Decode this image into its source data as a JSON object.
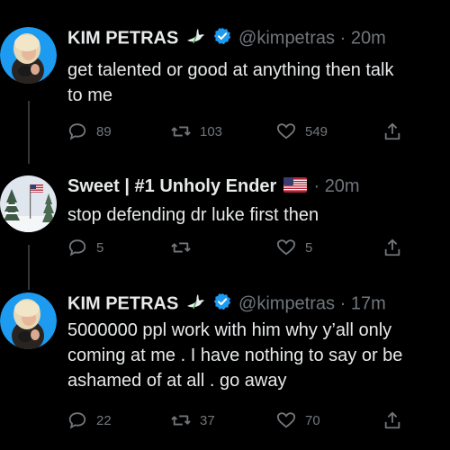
{
  "tweets": [
    {
      "name": "KIM PETRAS",
      "handle": "@kimpetras",
      "time": "20m",
      "text": "get talented or good at anything then talk\nto me",
      "replies": "89",
      "retweets": "103",
      "likes": "549",
      "verified": true,
      "emoji": "dove-emoji"
    },
    {
      "name": "Sweet | #1 Unholy Ender",
      "handle": "",
      "time": "20m",
      "text": "stop defending dr luke first then",
      "replies": "5",
      "retweets": "",
      "likes": "5",
      "verified": false,
      "emoji": "us-flag-emoji"
    },
    {
      "name": "KIM PETRAS",
      "handle": "@kimpetras",
      "time": "17m",
      "text": "5000000 ppl work with him why y’all only\ncoming at me . I have nothing to say or be\nashamed of at all . go away",
      "replies": "22",
      "retweets": "37",
      "likes": "70",
      "verified": true,
      "emoji": "dove-emoji"
    }
  ],
  "colors": {
    "background": "#000000",
    "text": "#e7e9ea",
    "muted": "#71767b",
    "verified": "#1d9bf0",
    "avatar_ring": "#1d9bf0"
  },
  "separator": "·"
}
